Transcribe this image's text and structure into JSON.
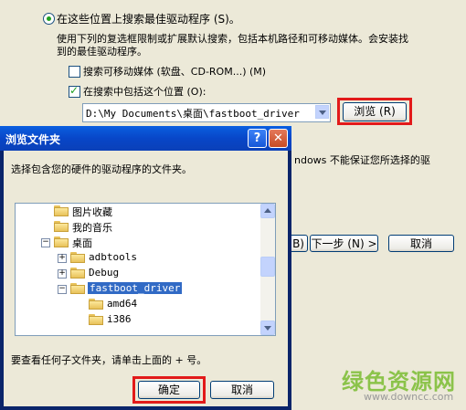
{
  "wizard": {
    "radio_search_label": "在这些位置上搜索最佳驱动程序 (S)。",
    "description_line1": "使用下列的复选框限制或扩展默认搜索，包括本机路径和可移动媒体。会安装找",
    "description_line2": "到的最佳驱动程序。",
    "check_removable_label": "搜索可移动媒体 (软盘、CD-ROM...) (M)",
    "check_include_label": "在搜索中包括这个位置 (O):",
    "path_value": "D:\\My Documents\\桌面\\fastboot_driver",
    "browse_label": "浏览 (R)",
    "partial_text": "ndows 不能保证您所选择的驱",
    "back_partial_label": "B)",
    "next_label": "下一步 (N) >",
    "cancel_label": "取消"
  },
  "dialog": {
    "title": "浏览文件夹",
    "help_label": "?",
    "close_label": "✕",
    "instruction": "选择包含您的硬件的驱动程序的文件夹。",
    "tree": [
      {
        "label": "图片收藏",
        "expander": ""
      },
      {
        "label": "我的音乐",
        "expander": ""
      },
      {
        "label": "桌面",
        "expander": "−"
      },
      {
        "label": "adbtools",
        "expander": "+"
      },
      {
        "label": "Debug",
        "expander": "+"
      },
      {
        "label": "fastboot_driver",
        "expander": "−"
      },
      {
        "label": "amd64",
        "expander": ""
      },
      {
        "label": "i386",
        "expander": ""
      }
    ],
    "hint": "要查看任何子文件夹，请单击上面的 + 号。",
    "ok_label": "确定",
    "cancel_label": "取消"
  },
  "watermark": {
    "text_cn": "绿色资源网",
    "url": "www.downcc.com"
  }
}
